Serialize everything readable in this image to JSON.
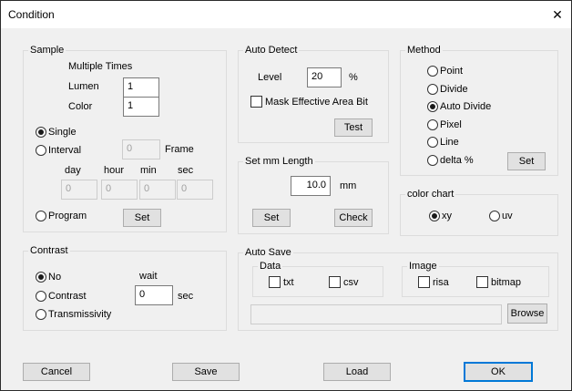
{
  "window": {
    "title": "Condition",
    "close_glyph": "✕"
  },
  "sample": {
    "title": "Sample",
    "multiple_times": "Multiple Times",
    "lumen_label": "Lumen",
    "lumen_value": "1",
    "color_label": "Color",
    "color_value": "1",
    "single": "Single",
    "interval": "Interval",
    "interval_value": "0",
    "frame": "Frame",
    "day": "day",
    "hour": "hour",
    "min": "min",
    "sec": "sec",
    "day_value": "0",
    "hour_value": "0",
    "min_value": "0",
    "sec_value": "0",
    "program": "Program",
    "set": "Set",
    "selected": "single"
  },
  "contrast": {
    "title": "Contrast",
    "no": "No",
    "contrast": "Contrast",
    "transmissivity": "Transmissivity",
    "wait": "wait",
    "wait_value": "0",
    "sec": "sec",
    "selected": "no"
  },
  "auto_detect": {
    "title": "Auto Detect",
    "level": "Level",
    "level_value": "20",
    "percent": "%",
    "mask": "Mask Effective Area Bit",
    "test": "Test"
  },
  "mm_length": {
    "title": "Set mm Length",
    "value": "10.0",
    "unit": "mm",
    "set": "Set",
    "check": "Check"
  },
  "method": {
    "title": "Method",
    "options": [
      "Point",
      "Divide",
      "Auto Divide",
      "Pixel",
      "Line",
      "delta %"
    ],
    "selected": "Auto Divide",
    "set": "Set"
  },
  "color_chart": {
    "title": "color chart",
    "xy": "xy",
    "uv": "uv",
    "selected": "xy"
  },
  "auto_save": {
    "title": "Auto Save",
    "data": "Data",
    "txt": "txt",
    "csv": "csv",
    "image": "Image",
    "risa": "risa",
    "bitmap": "bitmap",
    "path_value": "",
    "browse": "Browse"
  },
  "footer": {
    "cancel": "Cancel",
    "save": "Save",
    "load": "Load",
    "ok": "OK"
  },
  "colors": {
    "accent": "#0078d7",
    "dialog_bg": "#f0f0f0",
    "group_border": "#dcdcdc"
  }
}
